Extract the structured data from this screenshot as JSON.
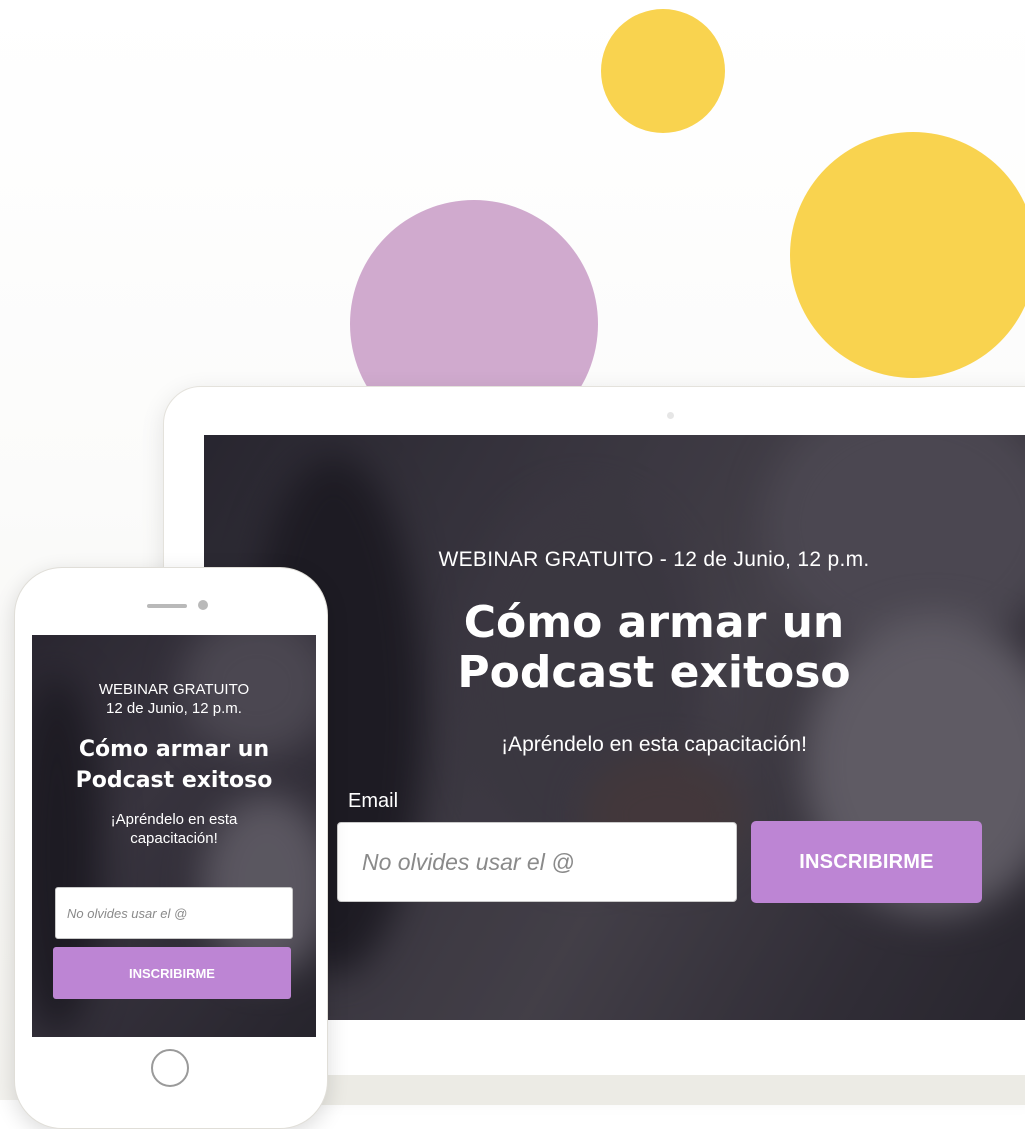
{
  "colors": {
    "accent_purple": "#bd85d4",
    "circle_yellow": "#f9d34f",
    "circle_purple": "#d0aace",
    "screen_dark": "#3e3a43"
  },
  "tablet": {
    "eyebrow": "WEBINAR GRATUITO - 12 de Junio, 12 p.m.",
    "title_line1": "Cómo armar un",
    "title_line2": "Podcast exitoso",
    "subtitle": "¡Apréndelo en esta capacitación!",
    "email_label": "Email",
    "email_placeholder": "No olvides usar el @",
    "button_label": "INSCRIBIRME"
  },
  "phone": {
    "eyebrow_line1": "WEBINAR GRATUITO",
    "eyebrow_line2": "12 de Junio, 12 p.m.",
    "title_line1": "Cómo armar un",
    "title_line2": "Podcast exitoso",
    "subtitle_line1": "¡Apréndelo en esta",
    "subtitle_line2": "capacitación!",
    "email_placeholder": "No olvides usar el @",
    "button_label": "INSCRIBIRME"
  }
}
